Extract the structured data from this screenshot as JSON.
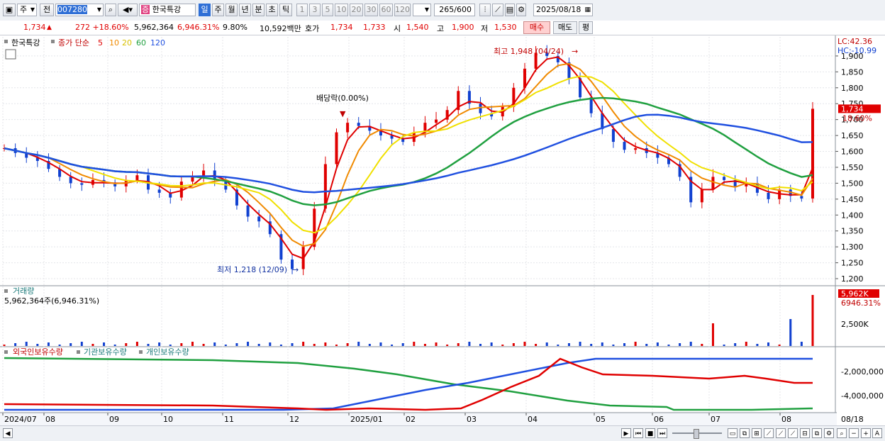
{
  "toolbar": {
    "market_label": "주",
    "prev_label": "전",
    "code": "007280",
    "stock_name": "한국특강",
    "periods": [
      "일",
      "주",
      "월",
      "년",
      "분",
      "초",
      "틱"
    ],
    "intervals": [
      "1",
      "3",
      "5",
      "10",
      "20",
      "30",
      "60",
      "120"
    ],
    "count": "265",
    "count_total": "/600",
    "date": "2025/08/18"
  },
  "quote": {
    "price": "1,734",
    "change": "272 +18.60%",
    "volume": "5,962,364",
    "volume_pct": "6,946.31%",
    "turnover": "9.80%",
    "amount": "10,592백만",
    "ask_label": "호가",
    "ask": "1,734",
    "bid": "1,733",
    "open_label": "시",
    "open": "1,540",
    "high_label": "고",
    "high": "1,900",
    "low_label": "저",
    "low": "1,530",
    "buy_label": "매수",
    "sell_label": "매도",
    "eval_label": "평"
  },
  "legend": {
    "name": "한국특강",
    "price_type": "종가 단순",
    "ma5": "5",
    "ma10": "10",
    "ma20": "20",
    "ma60": "60",
    "ma120": "120"
  },
  "colors": {
    "up": "#e00000",
    "down": "#1040d0",
    "ma5": "#e00000",
    "ma10": "#f08a00",
    "ma20": "#f0e000",
    "ma60": "#20a040",
    "ma120": "#2050e0"
  },
  "annotations": {
    "high": "최고 1,948 (04/24)",
    "low": "최저 1,218 (12/09)",
    "dividend": "배당락(0.00%)"
  },
  "right_panel": {
    "lc": "LC:42.36",
    "hc": "HC:-10.99",
    "price_tag": "1,734",
    "pct_tag": "18.60%",
    "price_ticks": [
      "1,900",
      "1,850",
      "1,800",
      "1,750",
      "1,700",
      "1,650",
      "1,600",
      "1,550",
      "1,500",
      "1,450",
      "1,400",
      "1,350",
      "1,300",
      "1,250",
      "1,200"
    ],
    "vol_tag": "5,962K",
    "vol_pct": "6946.31%",
    "vol_tick": "2,500K",
    "holding_ticks": [
      "-2,000,000",
      "-4,000,000"
    ]
  },
  "volume_panel": {
    "title": "거래량",
    "value": "5,962,364주(6,946.31%)"
  },
  "holding_panel": {
    "foreign": "외국인보유수량",
    "inst": "기관보유수량",
    "indiv": "개인보유수량"
  },
  "x_axis": [
    "2024/07",
    "08",
    "09",
    "10",
    "11",
    "12",
    "2025/01",
    "02",
    "03",
    "04",
    "05",
    "06",
    "07",
    "08",
    "08/18"
  ],
  "chart_data": {
    "type": "candlestick",
    "title": "한국특강",
    "ylim": [
      1180,
      1960
    ],
    "months": [
      "2024/07",
      "08",
      "09",
      "10",
      "11",
      "12",
      "2025/01",
      "02",
      "03",
      "04",
      "05",
      "06",
      "07",
      "08"
    ],
    "close_series": {
      "name": "종가",
      "values": [
        1610,
        1595,
        1580,
        1570,
        1545,
        1520,
        1500,
        1495,
        1510,
        1500,
        1490,
        1510,
        1525,
        1480,
        1470,
        1455,
        1505,
        1520,
        1540,
        1510,
        1480,
        1430,
        1395,
        1380,
        1340,
        1260,
        1230,
        1300,
        1420,
        1560,
        1660,
        1690,
        1680,
        1665,
        1650,
        1640,
        1630,
        1660,
        1690,
        1700,
        1730,
        1790,
        1750,
        1720,
        1710,
        1740,
        1800,
        1860,
        1910,
        1900,
        1880,
        1830,
        1770,
        1720,
        1670,
        1630,
        1605,
        1610,
        1595,
        1580,
        1560,
        1520,
        1440,
        1480,
        1520,
        1510,
        1490,
        1500,
        1470,
        1450,
        1480,
        1460,
        1452,
        1734
      ]
    },
    "annotations": {
      "high": {
        "label": "최고 1,948 (04/24)",
        "value": 1948
      },
      "low": {
        "label": "최저 1,218 (12/09)",
        "value": 1218
      }
    },
    "last_price": 1734,
    "volume": {
      "last": "5,962K",
      "tick": "2,500K"
    }
  }
}
